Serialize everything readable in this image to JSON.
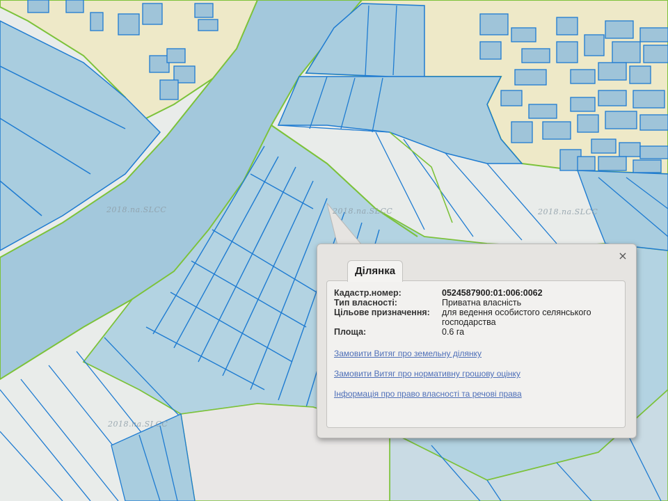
{
  "map": {
    "watermarks": [
      "2018.na.SLCC",
      "2018.na.SLCC",
      "2018.na.SLCC",
      "2018.na.SLCC"
    ],
    "colors": {
      "parcel_fill": "#a9cddf",
      "parcel_stroke": "#1e7bd1",
      "boundary_stroke": "#7cc23a",
      "background": "#e9ecea",
      "village_bg": "#eee9c8",
      "building_fill": "#9fc4d9",
      "river_fill": "#a3c8dc"
    }
  },
  "popup": {
    "tab_label": "Ділянка",
    "close_label": "×",
    "fields": [
      {
        "key": "Кадастр.номер:",
        "value": "0524587900:01:006:0062"
      },
      {
        "key": "Тип власності:",
        "value": "Приватна власність"
      },
      {
        "key": "Цільове призначення:",
        "value": "для ведення особистого селянського господарства"
      },
      {
        "key": "Площа:",
        "value": "0.6 га"
      }
    ],
    "links": [
      "Замовити Витяг про земельну ділянку",
      "Замовити Витяг про нормативну грошову оцінку",
      "Інформація про право власності та речові права"
    ]
  }
}
